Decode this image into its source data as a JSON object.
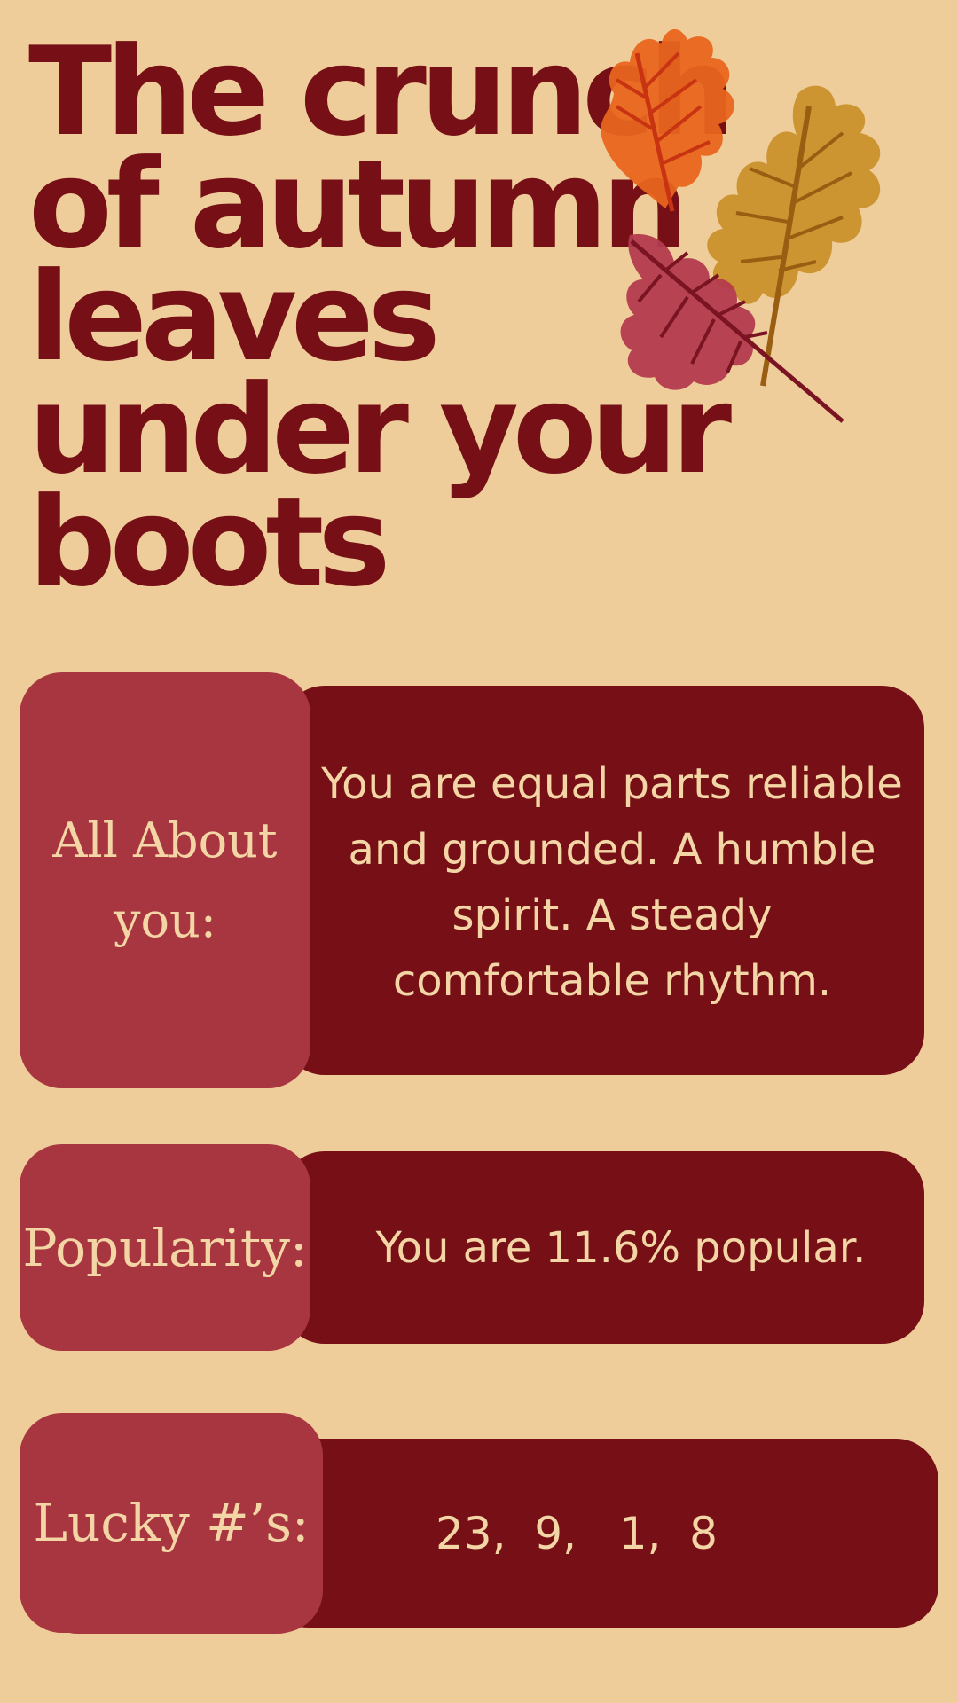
{
  "title_lines": [
    "The crunch",
    "of autumn",
    "leaves",
    "under your",
    "boots"
  ],
  "cards": {
    "about": {
      "label": "All About you:",
      "text": "You are equal parts reliable and grounded. A humble spirit. A steady comfortable rhythm."
    },
    "popularity": {
      "label": "Popularity:",
      "text": "You are 11.6% popular."
    },
    "lucky": {
      "label": "Lucky #’s:",
      "text": "23,  9,   1,  8"
    }
  },
  "colors": {
    "background": "#EFCD9B",
    "dark_panel": "#761016",
    "label_tab": "#A83640",
    "text_light": "#F3D5A6"
  },
  "icons": [
    "orange-oak-leaf-icon",
    "golden-oak-leaf-icon",
    "red-leaf-icon"
  ]
}
